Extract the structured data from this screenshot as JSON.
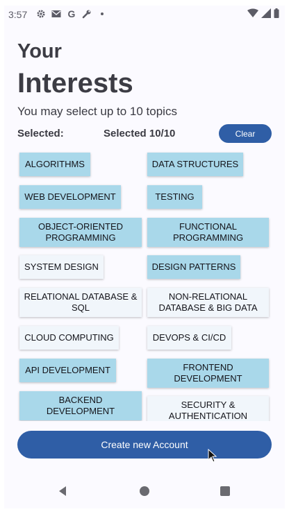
{
  "status_bar": {
    "time": "3:57",
    "icons": [
      "gear-icon",
      "mail-icon",
      "google-icon",
      "wrench-icon",
      "dot-icon"
    ],
    "right_icons": [
      "wifi-icon",
      "signal-icon",
      "battery-icon"
    ]
  },
  "header": {
    "title_line1": "Your",
    "title_line2": "Interests",
    "subtitle": "You may select up to 10 topics"
  },
  "selection": {
    "label": "Selected:",
    "count_text": "Selected 10/10",
    "clear_label": "Clear"
  },
  "topics": [
    {
      "label": "ALGORITHMS",
      "selected": true
    },
    {
      "label": "DATA STRUCTURES",
      "selected": true
    },
    {
      "label": "WEB DEVELOPMENT",
      "selected": true
    },
    {
      "label": "TESTING",
      "selected": true
    },
    {
      "label": "OBJECT-ORIENTED PROGRAMMING",
      "selected": true
    },
    {
      "label": "FUNCTIONAL PROGRAMMING",
      "selected": true
    },
    {
      "label": "SYSTEM DESIGN",
      "selected": false
    },
    {
      "label": "DESIGN PATTERNS",
      "selected": true
    },
    {
      "label": "RELATIONAL DATABASE & SQL",
      "selected": false
    },
    {
      "label": "NON-RELATIONAL DATABASE & BIG DATA",
      "selected": false
    },
    {
      "label": "CLOUD COMPUTING",
      "selected": false
    },
    {
      "label": "DEVOPS & CI/CD",
      "selected": false
    },
    {
      "label": "API DEVELOPMENT",
      "selected": true
    },
    {
      "label": "FRONTEND DEVELOPMENT",
      "selected": true
    },
    {
      "label": "BACKEND DEVELOPMENT",
      "selected": true
    },
    {
      "label": "SECURITY & AUTHENTICATION",
      "selected": false
    }
  ],
  "actions": {
    "create_label": "Create new Account"
  },
  "nav_bar": {
    "icons": [
      "back-icon",
      "home-icon",
      "recents-icon"
    ]
  },
  "colors": {
    "accent": "#2f5ea6",
    "chip_selected": "#a9d8ea",
    "chip_unselected": "#f1f6fb",
    "background": "#fbfaff"
  }
}
